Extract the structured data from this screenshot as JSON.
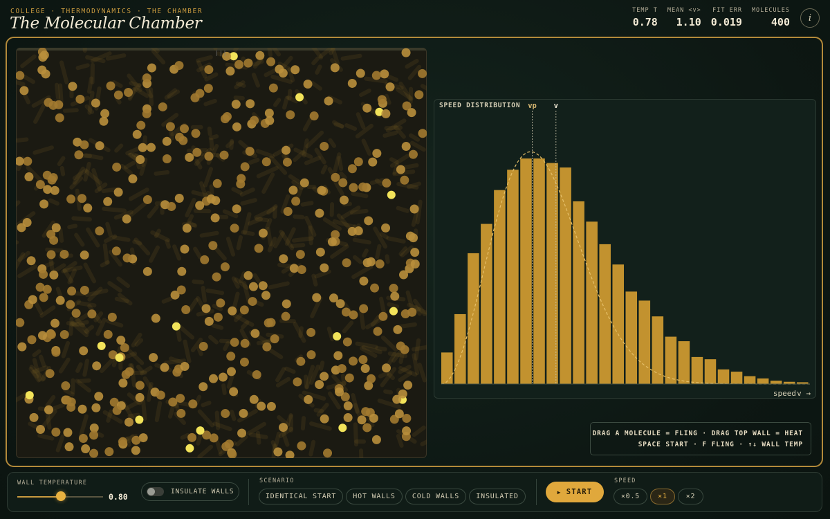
{
  "header": {
    "breadcrumb": "COLLEGE · THERMODYNAMICS · THE CHAMBER",
    "title": "The Molecular Chamber",
    "stats": [
      {
        "label": "TEMP T",
        "value": "0.78"
      },
      {
        "label": "MEAN <v>",
        "value": "1.10"
      },
      {
        "label": "FIT ERR",
        "value": "0.019"
      },
      {
        "label": "MOLECULES",
        "value": "400"
      }
    ],
    "info_icon": "info-icon"
  },
  "chamber": {
    "handle": "|||",
    "molecule_count": 400
  },
  "distribution": {
    "title": "SPEED DISTRIBUTION",
    "marker_vp": "vp",
    "marker_v": "v",
    "xlabel": "speed",
    "x_arrow": "v →"
  },
  "chart_data": {
    "type": "bar",
    "title": "SPEED DISTRIBUTION",
    "xlabel": "speed",
    "ylabel": "",
    "values": [
      0.14,
      0.31,
      0.58,
      0.71,
      0.86,
      0.95,
      1.0,
      1.0,
      0.98,
      0.96,
      0.81,
      0.72,
      0.62,
      0.53,
      0.41,
      0.37,
      0.3,
      0.21,
      0.19,
      0.12,
      0.11,
      0.065,
      0.055,
      0.035,
      0.025,
      0.015,
      0.01,
      0.008
    ],
    "fit_curve": "Maxwell-Boltzmann (dashed)",
    "markers": [
      {
        "label": "vp",
        "bin": 7
      },
      {
        "label": "v",
        "bin": 8.8
      }
    ]
  },
  "hint": {
    "line1": "DRAG A MOLECULE = FLING · DRAG TOP WALL = HEAT",
    "line2": "SPACE START · F FLING · ↑↓ WALL TEMP"
  },
  "controls": {
    "wall_temp_label": "WALL TEMPERATURE",
    "wall_temp_value": "0.80",
    "wall_temp_fraction": 0.5,
    "insulate_label": "INSULATE WALLS",
    "insulate_on": false,
    "scenario_label": "SCENARIO",
    "scenarios": [
      "IDENTICAL START",
      "HOT WALLS",
      "COLD WALLS",
      "INSULATED"
    ],
    "start_label": "START",
    "start_icon": "play-icon",
    "speed_label": "SPEED",
    "speeds": [
      "×0.5",
      "×1",
      "×2"
    ],
    "speed_selected": "×1"
  },
  "colors": {
    "accent": "#e0a83c",
    "bar": "#c2922f",
    "background": "#0f1a16"
  }
}
